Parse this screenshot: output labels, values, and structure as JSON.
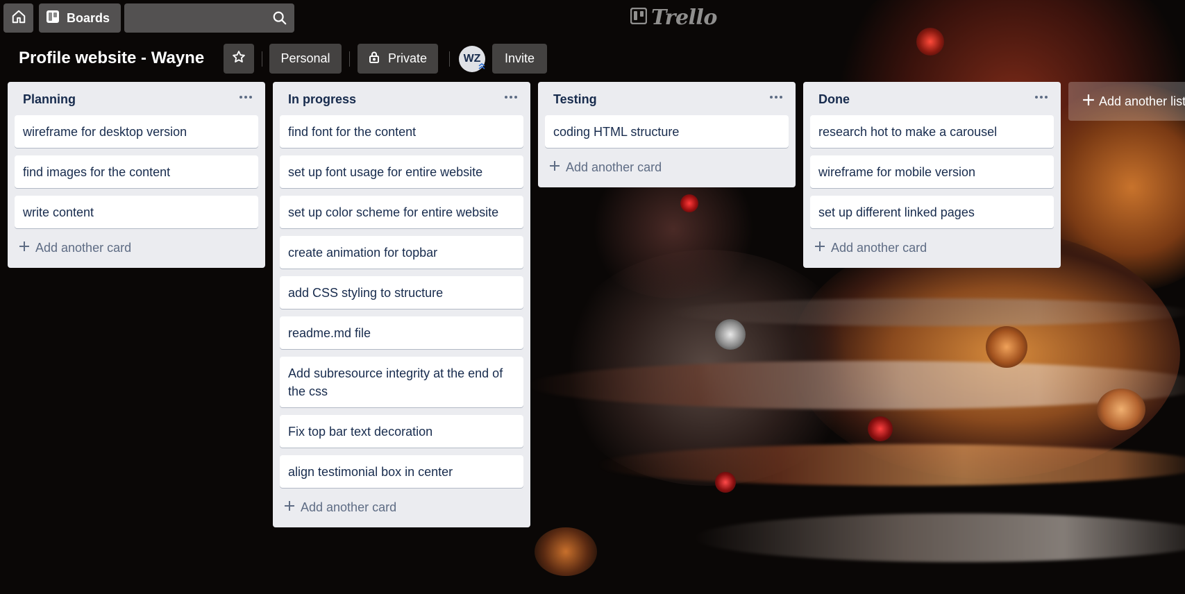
{
  "nav": {
    "boards_label": "Boards",
    "search_value": "",
    "search_placeholder": "",
    "logo_text": "Trello"
  },
  "board": {
    "title": "Profile website - Wayne",
    "visibility_team": "Personal",
    "visibility": "Private",
    "member_initials": "WZ",
    "invite_label": "Invite",
    "add_list_label": "Add another list"
  },
  "lists": [
    {
      "title": "Planning",
      "cards": [
        "wireframe for desktop version",
        "find images for the content",
        "write content"
      ],
      "add_card_label": "Add another card"
    },
    {
      "title": "In progress",
      "cards": [
        "find font for the content",
        "set up font usage for entire website",
        "set up color scheme for entire website",
        "create animation for topbar",
        "add CSS styling to structure",
        "readme.md file",
        "Add subresource integrity at the end of the css",
        "Fix top bar text decoration",
        "align testimonial box in center"
      ],
      "add_card_label": "Add another card"
    },
    {
      "title": "Testing",
      "cards": [
        "coding HTML structure"
      ],
      "add_card_label": "Add another card"
    },
    {
      "title": "Done",
      "cards": [
        "research hot to make a carousel",
        "wireframe for mobile version",
        "set up different linked pages"
      ],
      "add_card_label": "Add another card"
    }
  ],
  "icons": {
    "home": "home-icon",
    "boards": "board-icon",
    "search": "search-icon",
    "star": "star-icon",
    "lock": "lock-icon",
    "list_menu": "more-icon",
    "add": "plus-icon",
    "logo": "trello-logo-icon"
  },
  "colors": {
    "list_bg": "#ebecf0",
    "card_bg": "#ffffff",
    "text": "#172b4d",
    "muted_text": "#5e6c84",
    "page_bg": "#0a0706"
  }
}
